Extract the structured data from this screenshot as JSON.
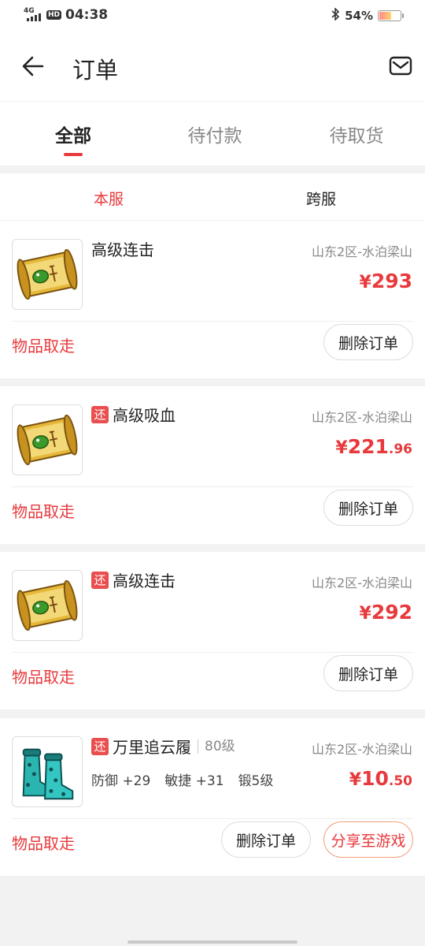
{
  "status_bar": {
    "network": "4G",
    "hd": "HD",
    "time": "04:38",
    "battery_text": "54%",
    "battery_level": 0.54,
    "icons": [
      "signal-icon",
      "bluetooth-icon",
      "battery-icon"
    ]
  },
  "header": {
    "title": "订单",
    "icons": [
      "back-arrow-icon",
      "mail-icon"
    ]
  },
  "tabs": [
    {
      "label": "全部",
      "active": true
    },
    {
      "label": "待付款",
      "active": false
    },
    {
      "label": "待取货",
      "active": false
    }
  ],
  "subtabs": [
    {
      "label": "本服",
      "active": true
    },
    {
      "label": "跨服",
      "active": false
    }
  ],
  "orders": [
    {
      "refund_badge": "",
      "name": "高级连击",
      "level": "",
      "server": "山东2区-水泊梁山",
      "price_currency": "¥",
      "price_int": "293",
      "price_dec": "",
      "attrs": [],
      "status": "物品取走",
      "delete_label": "删除订单",
      "share_label": "",
      "image_icon": "scroll-icon"
    },
    {
      "refund_badge": "还",
      "name": "高级吸血",
      "level": "",
      "server": "山东2区-水泊梁山",
      "price_currency": "¥",
      "price_int": "221",
      "price_dec": ".96",
      "attrs": [],
      "status": "物品取走",
      "delete_label": "删除订单",
      "share_label": "",
      "image_icon": "scroll-icon"
    },
    {
      "refund_badge": "还",
      "name": "高级连击",
      "level": "",
      "server": "山东2区-水泊梁山",
      "price_currency": "¥",
      "price_int": "292",
      "price_dec": "",
      "attrs": [],
      "status": "物品取走",
      "delete_label": "删除订单",
      "share_label": "",
      "image_icon": "scroll-icon"
    },
    {
      "refund_badge": "还",
      "name": "万里追云履",
      "level": "80级",
      "server": "山东2区-水泊梁山",
      "price_currency": "¥",
      "price_int": "10",
      "price_dec": ".50",
      "attrs": [
        "防御 +29",
        "敏捷 +31",
        "锻5级"
      ],
      "status": "物品取走",
      "delete_label": "删除订单",
      "share_label": "分享至游戏",
      "image_icon": "boots-icon"
    }
  ],
  "colors": {
    "accent": "#e8393c",
    "badge": "#ea4e4e",
    "background": "#f2f2f2"
  }
}
